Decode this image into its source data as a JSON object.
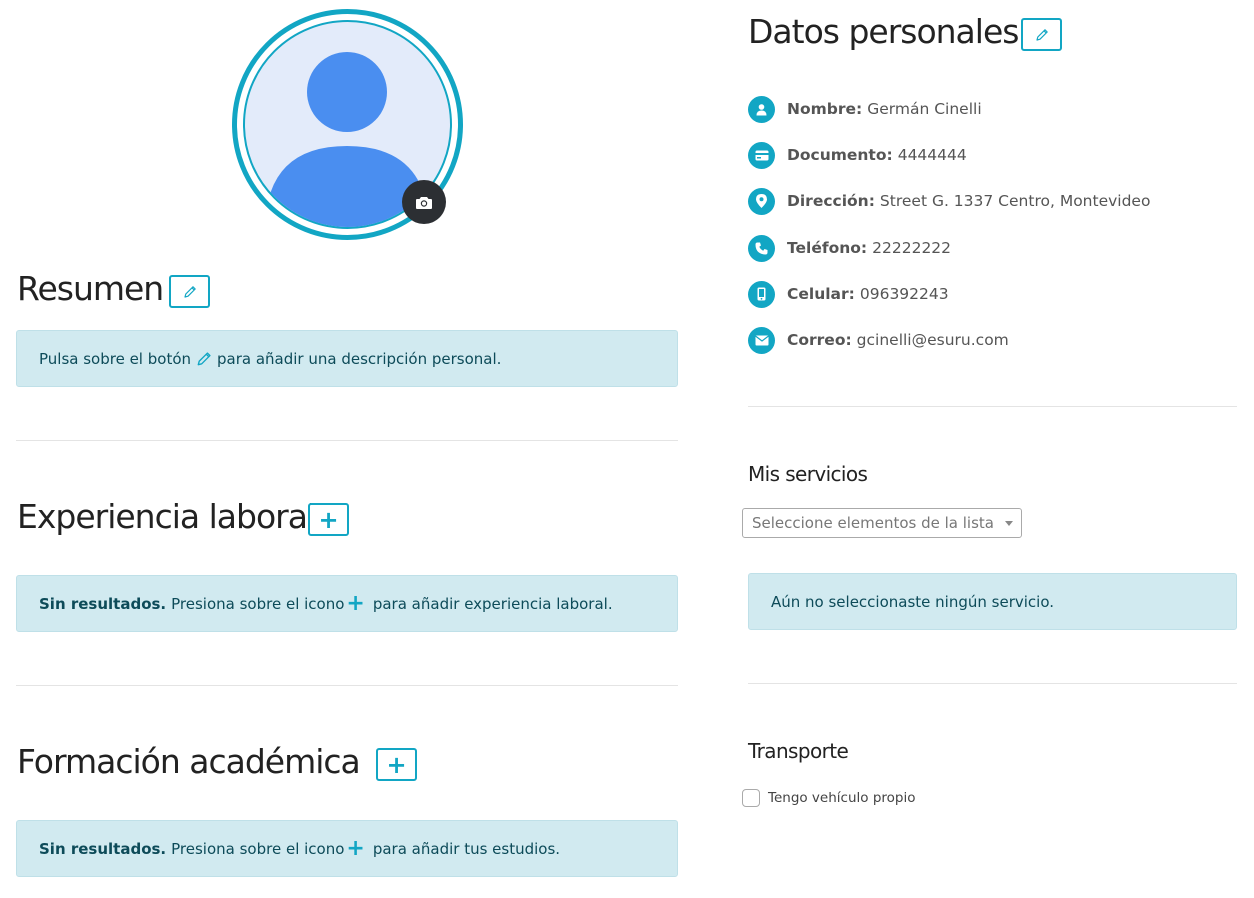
{
  "profile": {
    "camera_icon": "camera-icon"
  },
  "resumen": {
    "title": "Resumen",
    "edit_icon": "pencil-icon",
    "alert_before": "Pulsa sobre el botón",
    "alert_after": "para añadir una descripción personal."
  },
  "experiencia": {
    "title": "Experiencia laboral",
    "add_label": "+",
    "alert_bold": "Sin resultados.",
    "alert_before": "Presiona sobre el icono",
    "alert_plus": "+",
    "alert_after": "para añadir experiencia laboral."
  },
  "formacion": {
    "title": "Formación académica",
    "add_label": "+",
    "alert_bold": "Sin resultados.",
    "alert_before": "Presiona sobre el icono",
    "alert_plus": "+",
    "alert_after": "para añadir tus estudios."
  },
  "datos": {
    "title": "Datos personales",
    "edit_icon": "pencil-icon",
    "items": [
      {
        "label": "Nombre:",
        "value": "Germán Cinelli",
        "icon": "user-icon"
      },
      {
        "label": "Documento:",
        "value": "4444444",
        "icon": "credit-card-icon"
      },
      {
        "label": "Dirección:",
        "value": "Street G. 1337 Centro, Montevideo",
        "icon": "map-pin-icon"
      },
      {
        "label": "Teléfono:",
        "value": "22222222",
        "icon": "phone-icon"
      },
      {
        "label": "Celular:",
        "value": "096392243",
        "icon": "mobile-icon"
      },
      {
        "label": "Correo:",
        "value": "gcinelli@esuru.com",
        "icon": "envelope-icon"
      }
    ]
  },
  "servicios": {
    "title": "Mis servicios",
    "select_placeholder": "Seleccione elementos de la lista",
    "alert": "Aún no seleccionaste ningún servicio."
  },
  "transporte": {
    "title": "Transporte",
    "checkbox_label": "Tengo vehículo propio",
    "checked": false
  },
  "colors": {
    "accent": "#12a6c4",
    "alert_bg": "#d1eaf0",
    "alert_text": "#0d4b59",
    "avatar_bg": "#e3ebfa",
    "avatar_figure": "#4a8ef0"
  }
}
